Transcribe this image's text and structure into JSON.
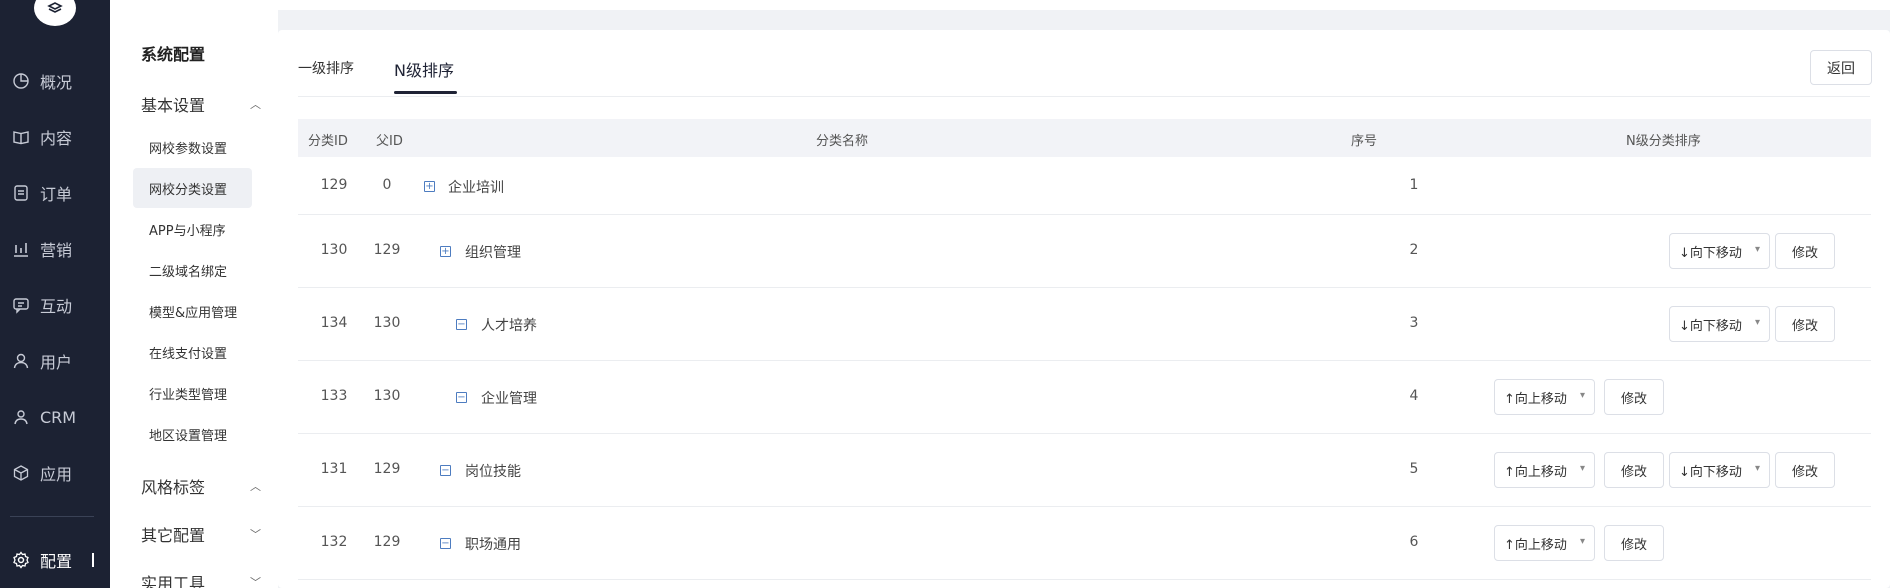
{
  "nav": {
    "items": [
      {
        "label": "概况",
        "icon": "pie-chart-icon"
      },
      {
        "label": "内容",
        "icon": "book-icon"
      },
      {
        "label": "订单",
        "icon": "document-icon"
      },
      {
        "label": "营销",
        "icon": "bar-chart-icon"
      },
      {
        "label": "互动",
        "icon": "chat-icon"
      },
      {
        "label": "用户",
        "icon": "user-icon"
      },
      {
        "label": "CRM",
        "icon": "contacts-icon"
      },
      {
        "label": "应用",
        "icon": "cube-icon"
      }
    ],
    "active": {
      "label": "配置",
      "icon": "gear-icon"
    }
  },
  "subnav": {
    "title": "系统配置",
    "groups": {
      "basic": "基本设置",
      "style": "风格标签",
      "other": "其它配置",
      "tools": "实用工具"
    },
    "items": [
      "网校参数设置",
      "网校分类设置",
      "APP与小程序",
      "二级域名绑定",
      "模型&应用管理",
      "在线支付设置",
      "行业类型管理",
      "地区设置管理"
    ],
    "active_index": 1
  },
  "tabs": [
    "一级排序",
    "N级排序"
  ],
  "active_tab": "N级排序",
  "back_label": "返回",
  "table": {
    "headers": [
      "分类ID",
      "父ID",
      "分类名称",
      "序号",
      "N级分类排序"
    ],
    "rows": [
      {
        "id": "129",
        "pid": "0",
        "name": "企业培训",
        "seq": "1",
        "expand": "+",
        "level": 0
      },
      {
        "id": "130",
        "pid": "129",
        "name": "组织管理",
        "seq": "2",
        "expand": "+",
        "level": 1
      },
      {
        "id": "134",
        "pid": "130",
        "name": "人才培养",
        "seq": "3",
        "expand": "−",
        "level": 2
      },
      {
        "id": "133",
        "pid": "130",
        "name": "企业管理",
        "seq": "4",
        "expand": "−",
        "level": 2
      },
      {
        "id": "131",
        "pid": "129",
        "name": "岗位技能",
        "seq": "5",
        "expand": "−",
        "level": 1
      },
      {
        "id": "132",
        "pid": "129",
        "name": "职场通用",
        "seq": "6",
        "expand": "−",
        "level": 1
      }
    ],
    "move_up": "↑向上移动",
    "move_down": "↓向下移动",
    "edit": "修改"
  }
}
